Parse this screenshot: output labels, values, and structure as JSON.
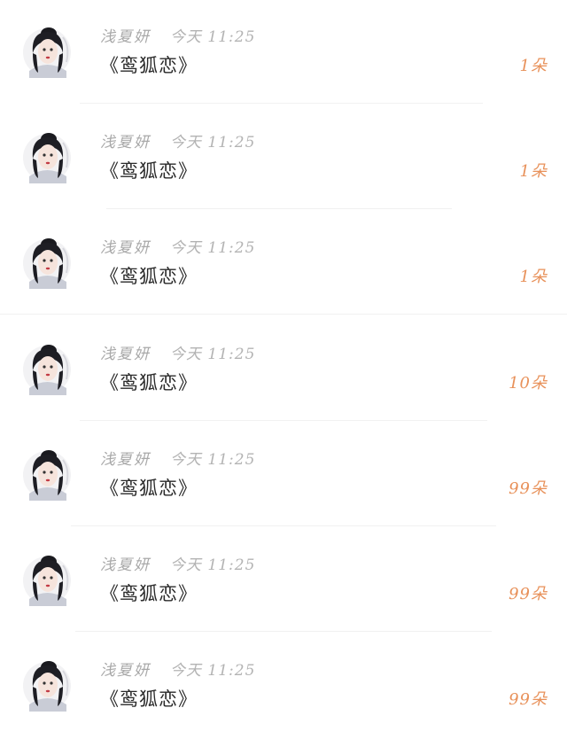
{
  "colors": {
    "name": "#a9a9a9",
    "time": "#b3b3b3",
    "title": "#2a2a2a",
    "count": "#e8915a",
    "divider": "#f1f1f1"
  },
  "gifts": [
    {
      "name": "浅夏妍",
      "time": "今天 11:25",
      "title": "《鸾狐恋》",
      "count": "1朵",
      "avatar_icon": "avatar-icon"
    },
    {
      "name": "浅夏妍",
      "time": "今天 11:25",
      "title": "《鸾狐恋》",
      "count": "1朵",
      "avatar_icon": "avatar-icon"
    },
    {
      "name": "浅夏妍",
      "time": "今天 11:25",
      "title": "《鸾狐恋》",
      "count": "1朵",
      "avatar_icon": "avatar-icon"
    },
    {
      "name": "浅夏妍",
      "time": "今天 11:25",
      "title": "《鸾狐恋》",
      "count": "10朵",
      "avatar_icon": "avatar-icon"
    },
    {
      "name": "浅夏妍",
      "time": "今天 11:25",
      "title": "《鸾狐恋》",
      "count": "99朵",
      "avatar_icon": "avatar-icon"
    },
    {
      "name": "浅夏妍",
      "time": "今天 11:25",
      "title": "《鸾狐恋》",
      "count": "99朵",
      "avatar_icon": "avatar-icon"
    },
    {
      "name": "浅夏妍",
      "time": "今天 11:25",
      "title": "《鸾狐恋》",
      "count": "99朵",
      "avatar_icon": "avatar-icon"
    }
  ]
}
